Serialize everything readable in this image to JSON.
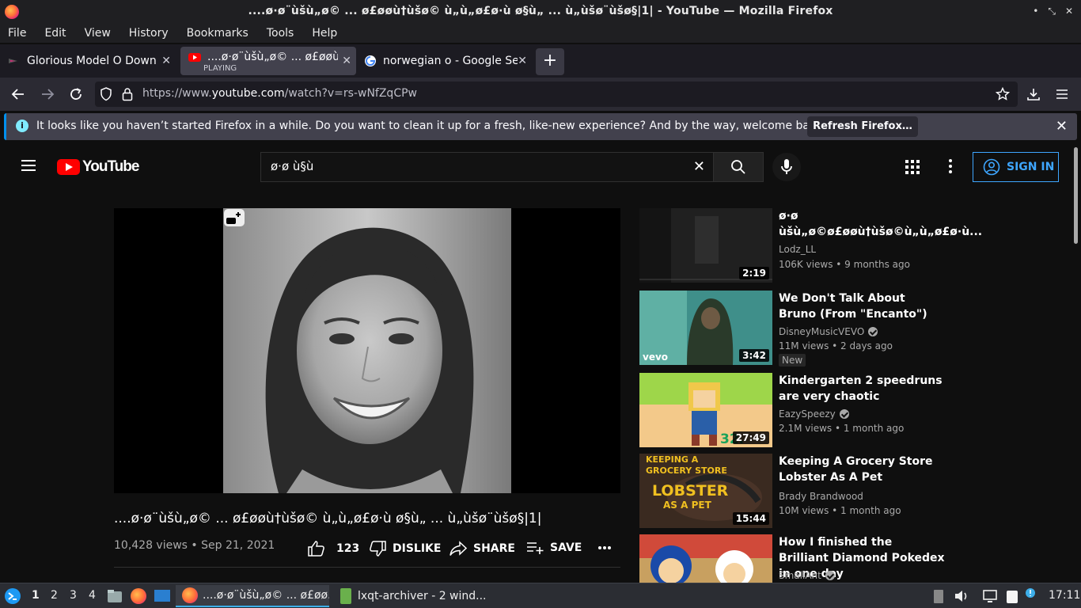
{
  "window": {
    "title": "....ø·ø¨ùšù„ø© ... ø£øøù†ùšø© ù„ù„ø£ø·ù ø§ù„ ... ù„ùšø¨ùšø§|1| - YouTube — Mozilla Firefox",
    "controls": [
      "•",
      "⤡",
      "✕"
    ]
  },
  "menu": [
    "File",
    "Edit",
    "View",
    "History",
    "Bookmarks",
    "Tools",
    "Help"
  ],
  "tabs": [
    {
      "label": "Glorious Model O Downlo",
      "sub": ""
    },
    {
      "label": "....ø·ø¨ùšù„ø© ... ø£øøù†ùšø",
      "sub": "PLAYING"
    },
    {
      "label": "norwegian o - Google Sea",
      "sub": ""
    }
  ],
  "newtab_label": "+",
  "url": {
    "prefix": "https://www.",
    "domain": "youtube.com",
    "path": "/watch?v=rs-wNfZqCPw"
  },
  "notification": {
    "message": "It looks like you haven’t started Firefox in a while. Do you want to clean it up for a fresh, like-new experience? And by the way, welcome back!",
    "button": "Refresh Firefox…",
    "info": "i",
    "close": "✕"
  },
  "youtube": {
    "logo_text": "YouTube",
    "search_value": "ø·ø ù§ù",
    "search_clear": "✕",
    "signin": "SIGN IN"
  },
  "video": {
    "title": "....ø·ø¨ùšù„ø© ... ø£øøù†ùšø© ù„ù„ø£ø·ù ø§ù„ ... ù„ùšø¨ùšø§|1|",
    "views": "10,428 views",
    "date": "Sep 21, 2021",
    "likes": "123",
    "dislike": "DISLIKE",
    "share": "SHARE",
    "save": "SAVE"
  },
  "recommendations": [
    {
      "title": "ø·ø ùšù„ø©ø£øøù†ùšø©ù„ù„ø£ø·ù...",
      "channel": "Lodz_LL",
      "verified": false,
      "views": "106K views • 9 months ago",
      "duration": "2:19",
      "badge": ""
    },
    {
      "title": "We Don't Talk About Bruno (From \"Encanto\")",
      "channel": "DisneyMusicVEVO",
      "verified": true,
      "views": "11M views • 2 days ago",
      "duration": "3:42",
      "badge": "New",
      "thumb_text": "vevo"
    },
    {
      "title": "Kindergarten 2 speedruns are very chaotic",
      "channel": "EazySpeezy",
      "verified": true,
      "views": "2.1M views • 1 month ago",
      "duration": "27:49",
      "badge": "",
      "thumb_text": "32."
    },
    {
      "title": "Keeping A Grocery Store Lobster As A Pet",
      "channel": "Brady Brandwood",
      "verified": false,
      "views": "10M views • 1 month ago",
      "duration": "15:44",
      "badge": "",
      "thumb_text": [
        "KEEPING A",
        "GROCERY STORE",
        "LOBSTER",
        "AS A PET"
      ]
    },
    {
      "title": "How I finished the Brilliant Diamond Pokedex in one day",
      "channel": "SmallAnt",
      "verified": true,
      "views": "",
      "duration": "",
      "badge": ""
    }
  ],
  "taskbar": {
    "desktops": [
      "1",
      "2",
      "3",
      "4"
    ],
    "tasks": [
      "....ø·ø¨ùšù„ø© ... ø£øø...",
      "lxqt-archiver - 2 wind..."
    ],
    "clock": "17:11"
  },
  "colors": {
    "yt_red": "#ff0000",
    "link_blue": "#3ea6ff",
    "firefox_accent": "#0090ed"
  }
}
